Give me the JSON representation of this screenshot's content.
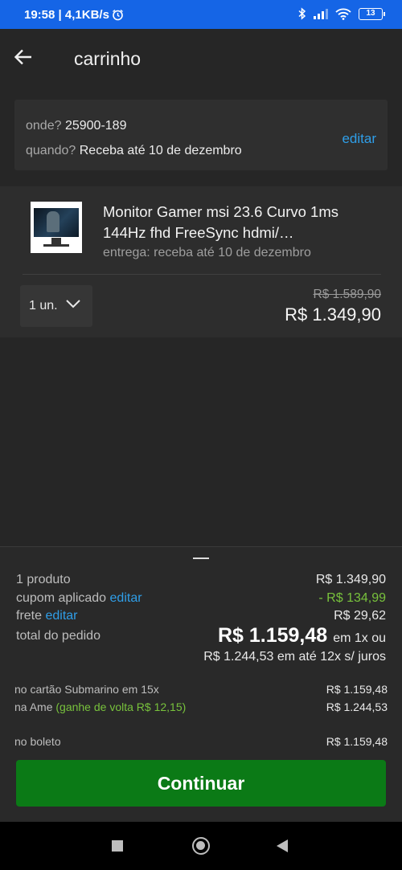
{
  "status_bar": {
    "time": "19:58",
    "net_speed": "| 4,1KB/s",
    "battery": "13",
    "icons": [
      "alarm-icon",
      "bluetooth-icon",
      "signal-icon",
      "wifi-icon",
      "battery-icon"
    ],
    "bg_color": "#1565e6"
  },
  "appbar": {
    "title": "carrinho",
    "back_icon": "arrow-left-icon"
  },
  "address": {
    "where_label": "onde?",
    "where_value": "25900-189",
    "when_label": "quando?",
    "when_value": "Receba até 10 de dezembro",
    "edit_label": "editar"
  },
  "product": {
    "title": "Monitor Gamer msi 23.6 Curvo 1ms 144Hz fhd FreeSync hdmi/…",
    "delivery": "entrega: receba até 10 de dezembro",
    "quantity": "1 un.",
    "old_price": "R$ 1.589,90",
    "price": "R$ 1.349,90"
  },
  "summary": {
    "products_label": "1 produto",
    "products_value": "R$ 1.349,90",
    "coupon_label": "cupom aplicado",
    "coupon_edit": "editar",
    "coupon_value": "- R$ 134,99",
    "shipping_label": "frete",
    "shipping_edit": "editar",
    "shipping_value": "R$ 29,62",
    "total_label": "total do pedido",
    "total_value": "R$ 1.159,48",
    "total_suffix": "em 1x ou",
    "installments": "R$ 1.244,53 em até 12x s/ juros"
  },
  "payment_options": {
    "card_label": "no cartão Submarino em 15x",
    "card_value": "R$ 1.159,48",
    "ame_label": "na Ame",
    "ame_cashback": "(ganhe de volta R$ 12,15)",
    "ame_value": "R$ 1.244,53",
    "boleto_label": "no boleto",
    "boleto_value": "R$ 1.159,48"
  },
  "continue_label": "Continuar",
  "colors": {
    "link": "#2f9ee8",
    "discount": "#78c23c",
    "primary_button": "#0b7a16"
  }
}
